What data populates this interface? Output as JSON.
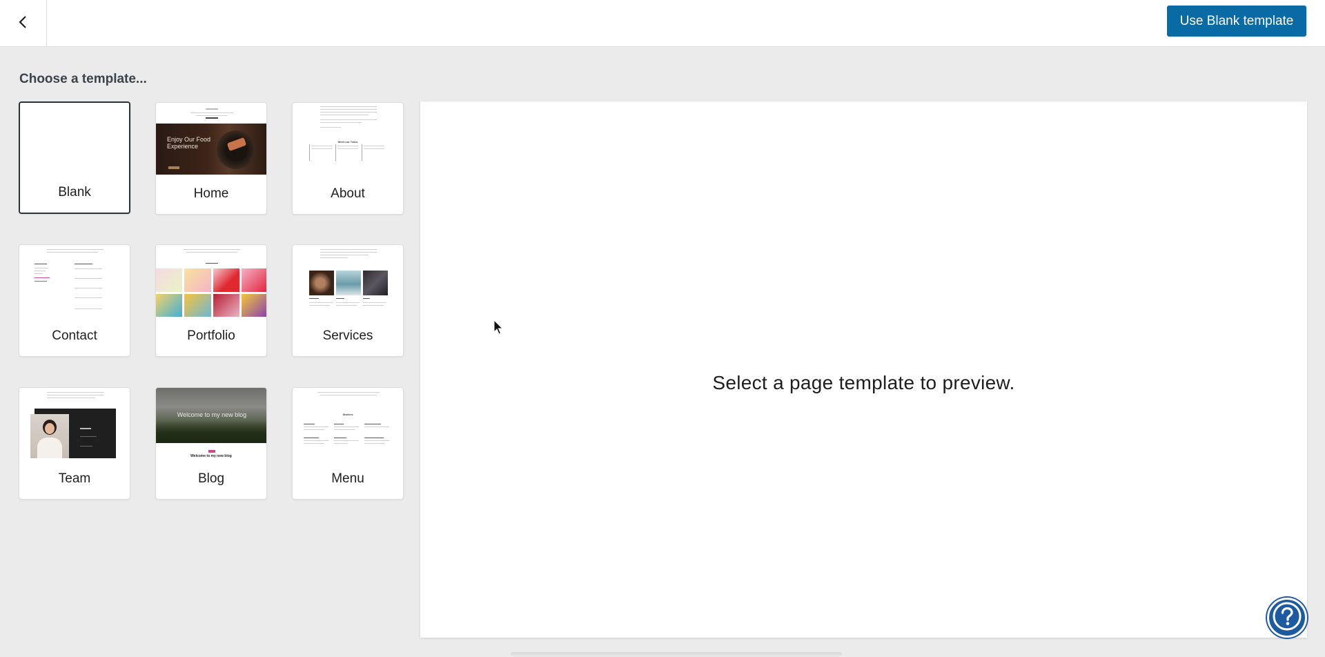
{
  "header": {
    "back_icon": "chevron-left-icon",
    "use_button_label": "Use Blank template"
  },
  "picker": {
    "heading": "Choose a template...",
    "templates": [
      {
        "label": "Blank",
        "selected": true
      },
      {
        "label": "Home",
        "thumb_text": "Enjoy Our Food Experience"
      },
      {
        "label": "About",
        "thumb_text": "Meet our Team"
      },
      {
        "label": "Contact"
      },
      {
        "label": "Portfolio"
      },
      {
        "label": "Services"
      },
      {
        "label": "Team"
      },
      {
        "label": "Blog",
        "thumb_text": "Welcome to my new blog",
        "thumb_subtitle": "Welcome to my new blog"
      },
      {
        "label": "Menu",
        "thumb_text": "Starters"
      }
    ]
  },
  "preview": {
    "message": "Select a page template to preview."
  },
  "help": {
    "icon": "help-question-icon"
  },
  "colors": {
    "primary_button": "#0a6ba4",
    "help_button": "#1d5aa0",
    "background": "#ebebeb"
  }
}
